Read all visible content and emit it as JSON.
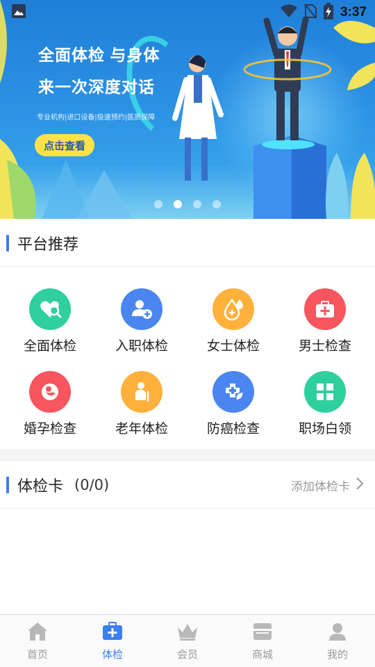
{
  "status_bar": {
    "time": "3:37"
  },
  "banner": {
    "title_line1": "全面体检 与身体",
    "title_line2": "来一次深度对话",
    "subtitle": "专业机构|进口设备|极速预约|医质保障",
    "cta": "点击查看",
    "carousel_index": 2,
    "carousel_total": 4
  },
  "platform": {
    "title": "平台推荐",
    "items": [
      {
        "label": "全面体检",
        "icon": "heart-search-icon",
        "color": "#2fcf9e"
      },
      {
        "label": "入职体检",
        "icon": "add-user-icon",
        "color": "#4a86f0"
      },
      {
        "label": "女士体检",
        "icon": "drop-plus-icon",
        "color": "#ffb13b"
      },
      {
        "label": "男士检查",
        "icon": "medkit-icon",
        "color": "#f7565f"
      },
      {
        "label": "婚孕检查",
        "icon": "baby-icon",
        "color": "#f7565f"
      },
      {
        "label": "老年体检",
        "icon": "elder-icon",
        "color": "#ffb13b"
      },
      {
        "label": "防癌检查",
        "icon": "cross-leaf-icon",
        "color": "#4a86f0"
      },
      {
        "label": "职场白领",
        "icon": "grid-icon",
        "color": "#2fcf9e"
      }
    ]
  },
  "card": {
    "title": "体检卡",
    "count": "(0/0)",
    "action": "添加体检卡"
  },
  "tabbar": {
    "active": 1,
    "items": [
      {
        "label": "首页",
        "icon": "home-icon"
      },
      {
        "label": "体检",
        "icon": "medical-kit-icon"
      },
      {
        "label": "会员",
        "icon": "crown-icon"
      },
      {
        "label": "商城",
        "icon": "shop-icon"
      },
      {
        "label": "我的",
        "icon": "user-icon"
      }
    ]
  },
  "colors": {
    "accent": "#3b7ff0",
    "inactive": "#9a9a9a"
  }
}
